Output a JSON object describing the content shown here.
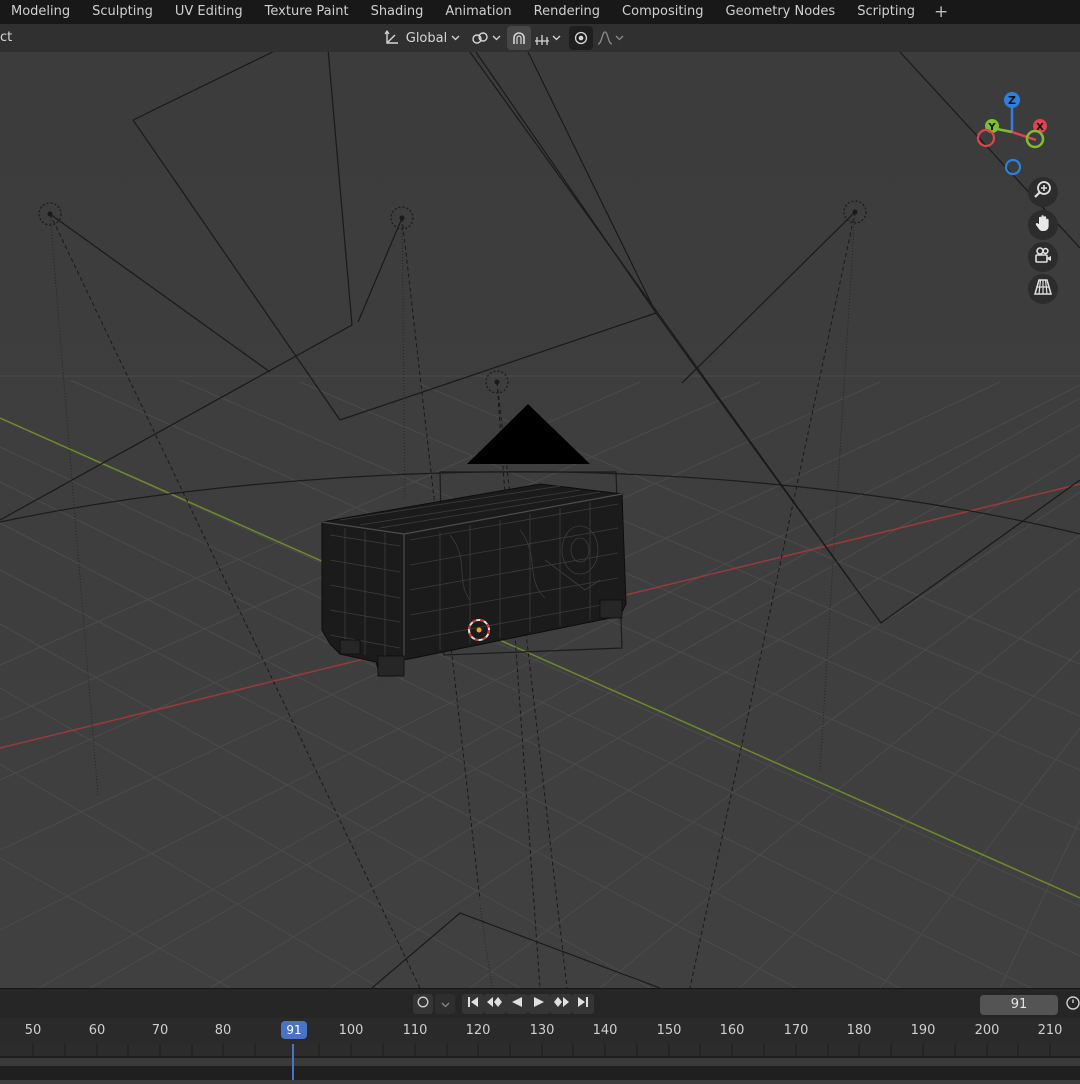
{
  "workspace_tabs": [
    "Modeling",
    "Sculpting",
    "UV Editing",
    "Texture Paint",
    "Shading",
    "Animation",
    "Rendering",
    "Compositing",
    "Geometry Nodes",
    "Scripting"
  ],
  "add_tab_label": "+",
  "header": {
    "left_label": "ct",
    "transform_orientation": "Global"
  },
  "gizmo": {
    "z": "Z",
    "y": "Y",
    "x": "X",
    "x_color": "#e0434f",
    "y_color": "#7fbf2b",
    "z_color": "#2f7fe0"
  },
  "nav_icons": [
    "zoom-icon",
    "pan-hand-icon",
    "camera-view-icon",
    "perspective-grid-icon"
  ],
  "timeline": {
    "current_frame": "91",
    "ticks": [
      "50",
      "60",
      "70",
      "80",
      "91",
      "100",
      "110",
      "120",
      "130",
      "140",
      "150",
      "160",
      "170",
      "180",
      "190",
      "200",
      "210"
    ]
  }
}
